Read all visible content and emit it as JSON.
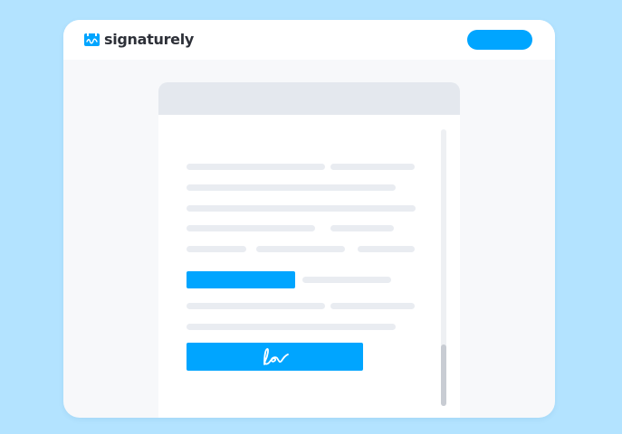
{
  "app": {
    "brand_name": "signaturely",
    "brand_color": "#00a5ff",
    "logo_icon": "signature-logo-icon"
  },
  "header": {
    "cta_button_label": ""
  },
  "document": {
    "fields": [
      {
        "type": "text-field",
        "icon": null
      },
      {
        "type": "signature-field",
        "icon": "signature-scribble-icon"
      }
    ]
  },
  "colors": {
    "background": "#b3e3ff",
    "accent": "#00a5ff",
    "placeholder_line": "#e9ecf1",
    "doc_header": "#e4e8ee"
  }
}
